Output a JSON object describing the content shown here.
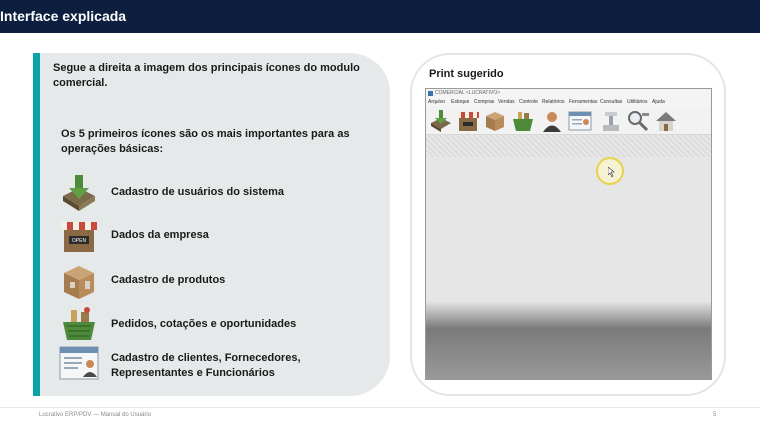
{
  "header": {
    "title": "Interface explicada"
  },
  "left": {
    "intro": "Segue a direita a imagem dos principais ícones do modulo comercial.",
    "subtext": "Os 5 primeiros ícones são os mais importantes para as operações básicas:",
    "items": [
      {
        "label": "Cadastro de usuários do sistema",
        "icon": "download-box-icon"
      },
      {
        "label": "Dados da empresa",
        "icon": "storefront-open-icon"
      },
      {
        "label": "Cadastro de produtos",
        "icon": "product-box-icon"
      },
      {
        "label": "Pedidos, cotações e oportunidades",
        "icon": "shopping-basket-icon"
      },
      {
        "label": "Cadastro de clientes, Fornecedores, Representantes e Funcionários",
        "icon": "contact-card-icon"
      }
    ]
  },
  "right": {
    "title": "Print sugerido",
    "app": {
      "window_title": "COMERCIAL <LUCRATIVO>",
      "menu": [
        "Arquivo",
        "Estoque",
        "Compras",
        "Vendas",
        "Controle",
        "Relatórios",
        "Ferramentas",
        "Consultas",
        "Utilitários",
        "Ajuda"
      ],
      "toolbar_icons": [
        "download-box-icon",
        "storefront-icon",
        "product-box-icon",
        "shopping-basket-icon",
        "person-icon",
        "contact-card-icon",
        "scale-icon",
        "magnifier-icon",
        "home-icon"
      ]
    }
  },
  "footer": {
    "left": "Lucrativo ERP/PDV — Manual do Usuário",
    "page": "5"
  },
  "colors": {
    "header": "#0c1f3f",
    "accent": "#0aa3a8",
    "panel": "#e5e9ea"
  }
}
